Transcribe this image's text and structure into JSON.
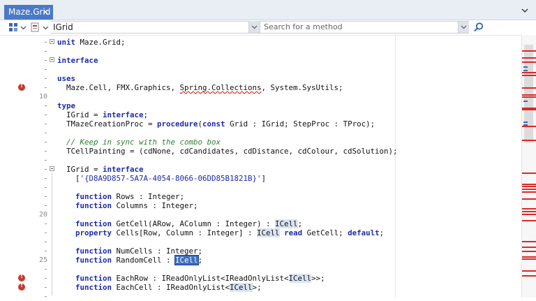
{
  "tab": {
    "title": "Maze.Grid",
    "close": "✕"
  },
  "toolbar": {
    "unit": "IGrid",
    "search_placeholder": "Search for a method"
  },
  "gutter": {
    "line_numbers": [
      {
        "line": 6,
        "label": "10"
      },
      {
        "line": 19,
        "label": "20"
      },
      {
        "line": 24,
        "label": "25"
      }
    ],
    "errors": [
      5,
      26,
      27
    ],
    "folds": [
      0,
      2,
      14
    ]
  },
  "code_lines": [
    [
      {
        "t": "unit",
        "c": "kw"
      },
      {
        "t": " Maze.Grid;"
      }
    ],
    [],
    [
      {
        "t": "interface",
        "c": "kw"
      }
    ],
    [],
    [
      {
        "t": "uses",
        "c": "kw"
      }
    ],
    [
      {
        "t": "  Maze.Cell, FMX.Graphics, "
      },
      {
        "t": "Spring.Collections",
        "c": "sq"
      },
      {
        "t": ", System.SysUtils;"
      }
    ],
    [],
    [
      {
        "t": "type",
        "c": "kw"
      }
    ],
    [
      {
        "t": "  IGrid = "
      },
      {
        "t": "interface",
        "c": "kw"
      },
      {
        "t": ";"
      }
    ],
    [
      {
        "t": "  TMazeCreationProc = "
      },
      {
        "t": "procedure",
        "c": "kw"
      },
      {
        "t": "("
      },
      {
        "t": "const",
        "c": "kw"
      },
      {
        "t": " Grid : IGrid; StepProc : TProc);"
      }
    ],
    [],
    [
      {
        "t": "  // Keep in sync with the combo box",
        "c": "cm"
      }
    ],
    [
      {
        "t": "  TCellPainting = (cdNone, cdCandidates, cdDistance, cdColour, cdSolution);"
      }
    ],
    [],
    [
      {
        "t": "  IGrid = "
      },
      {
        "t": "interface",
        "c": "kw"
      }
    ],
    [
      {
        "t": "    ["
      },
      {
        "t": "'{D8A9D857-5A7A-4054-8066-06DD85B1821B}'",
        "c": "str"
      },
      {
        "t": "]"
      }
    ],
    [],
    [
      {
        "t": "    "
      },
      {
        "t": "function",
        "c": "kw"
      },
      {
        "t": " Rows : Integer;"
      }
    ],
    [
      {
        "t": "    "
      },
      {
        "t": "function",
        "c": "kw"
      },
      {
        "t": " Columns : Integer;"
      }
    ],
    [],
    [
      {
        "t": "    "
      },
      {
        "t": "function",
        "c": "kw"
      },
      {
        "t": " GetCell(ARow, AColumn : Integer) : "
      },
      {
        "t": "ICell",
        "c": "hl"
      },
      {
        "t": ";"
      }
    ],
    [
      {
        "t": "    "
      },
      {
        "t": "property",
        "c": "kw"
      },
      {
        "t": " Cells[Row, Column : Integer] : "
      },
      {
        "t": "ICell",
        "c": "hl"
      },
      {
        "t": " "
      },
      {
        "t": "read",
        "c": "kw"
      },
      {
        "t": " GetCell; "
      },
      {
        "t": "default",
        "c": "kw"
      },
      {
        "t": ";"
      }
    ],
    [],
    [
      {
        "t": "    "
      },
      {
        "t": "function",
        "c": "kw"
      },
      {
        "t": " NumCells : Integer;"
      }
    ],
    [
      {
        "t": "    "
      },
      {
        "t": "function",
        "c": "kw"
      },
      {
        "t": " RandomCell : "
      },
      {
        "t": "ICell",
        "c": "sel"
      },
      {
        "t": ";"
      }
    ],
    [],
    [
      {
        "t": "    "
      },
      {
        "t": "function",
        "c": "kw"
      },
      {
        "t": " EachRow : IReadOnlyList<IReadOnlyList<"
      },
      {
        "t": "ICell",
        "c": "hl"
      },
      {
        "t": ">>;"
      }
    ],
    [
      {
        "t": "    "
      },
      {
        "t": "function",
        "c": "kw"
      },
      {
        "t": " EachCell : IReadOnlyList<"
      },
      {
        "t": "ICell",
        "c": "hl"
      },
      {
        "t": ">;"
      }
    ],
    []
  ],
  "scroll_marks": {
    "red": [
      22,
      32,
      38,
      53,
      57,
      75,
      85,
      88,
      104,
      106,
      130,
      150,
      197,
      213,
      216,
      220,
      224,
      234,
      248,
      252,
      256,
      265,
      295,
      303,
      309,
      317,
      320,
      337,
      344
    ],
    "blue": [
      45,
      50,
      94,
      124,
      128
    ]
  },
  "colors": {
    "tab_active": "#4a7ac6",
    "keyword": "#1e2aa8",
    "comment": "#2f7f35",
    "error": "#c43a2e",
    "selection": "#3c6fbf"
  }
}
